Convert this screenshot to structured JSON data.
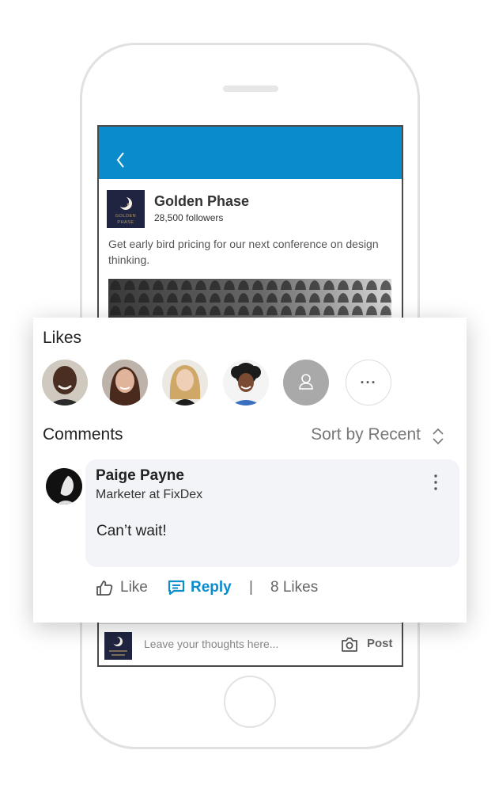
{
  "post": {
    "org_name": "Golden Phase",
    "followers": "28,500 followers",
    "text": "Get early bird pricing for our next conference on design thinking.",
    "logo_text_line1": "GOLDEN",
    "logo_text_line2": "PHASE"
  },
  "likes": {
    "title": "Likes",
    "avatars": [
      "avatar-man-smiling",
      "avatar-woman-brown-hair",
      "avatar-woman-blonde",
      "avatar-woman-curly-hair",
      "avatar-placeholder"
    ],
    "more_label": "···"
  },
  "comments": {
    "title": "Comments",
    "sort_label": "Sort by Recent",
    "items": [
      {
        "name": "Paige Payne",
        "title": "Marketer at FixDex",
        "text": "Can’t wait!",
        "like_label": "Like",
        "reply_label": "Reply",
        "separator": "|",
        "likes_count": "8 Likes"
      }
    ]
  },
  "composer": {
    "placeholder": "Leave your thoughts here...",
    "post_label": "Post"
  },
  "colors": {
    "header_blue": "#0a8ccc",
    "logo_navy": "#1f2540",
    "bubble_bg": "#f2f4f7"
  },
  "icons": [
    "back-icon",
    "sort-icon",
    "more-vertical-icon",
    "like-icon",
    "reply-icon",
    "camera-icon"
  ]
}
